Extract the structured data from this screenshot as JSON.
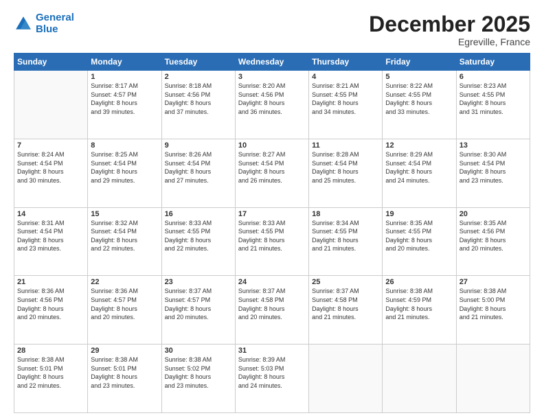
{
  "logo": {
    "line1": "General",
    "line2": "Blue"
  },
  "title": "December 2025",
  "location": "Egreville, France",
  "days_header": [
    "Sunday",
    "Monday",
    "Tuesday",
    "Wednesday",
    "Thursday",
    "Friday",
    "Saturday"
  ],
  "weeks": [
    [
      {
        "day": "",
        "sunrise": "",
        "sunset": "",
        "daylight": ""
      },
      {
        "day": "1",
        "sunrise": "Sunrise: 8:17 AM",
        "sunset": "Sunset: 4:57 PM",
        "daylight": "Daylight: 8 hours",
        "daylight2": "and 39 minutes."
      },
      {
        "day": "2",
        "sunrise": "Sunrise: 8:18 AM",
        "sunset": "Sunset: 4:56 PM",
        "daylight": "Daylight: 8 hours",
        "daylight2": "and 37 minutes."
      },
      {
        "day": "3",
        "sunrise": "Sunrise: 8:20 AM",
        "sunset": "Sunset: 4:56 PM",
        "daylight": "Daylight: 8 hours",
        "daylight2": "and 36 minutes."
      },
      {
        "day": "4",
        "sunrise": "Sunrise: 8:21 AM",
        "sunset": "Sunset: 4:55 PM",
        "daylight": "Daylight: 8 hours",
        "daylight2": "and 34 minutes."
      },
      {
        "day": "5",
        "sunrise": "Sunrise: 8:22 AM",
        "sunset": "Sunset: 4:55 PM",
        "daylight": "Daylight: 8 hours",
        "daylight2": "and 33 minutes."
      },
      {
        "day": "6",
        "sunrise": "Sunrise: 8:23 AM",
        "sunset": "Sunset: 4:55 PM",
        "daylight": "Daylight: 8 hours",
        "daylight2": "and 31 minutes."
      }
    ],
    [
      {
        "day": "7",
        "sunrise": "Sunrise: 8:24 AM",
        "sunset": "Sunset: 4:54 PM",
        "daylight": "Daylight: 8 hours",
        "daylight2": "and 30 minutes."
      },
      {
        "day": "8",
        "sunrise": "Sunrise: 8:25 AM",
        "sunset": "Sunset: 4:54 PM",
        "daylight": "Daylight: 8 hours",
        "daylight2": "and 29 minutes."
      },
      {
        "day": "9",
        "sunrise": "Sunrise: 8:26 AM",
        "sunset": "Sunset: 4:54 PM",
        "daylight": "Daylight: 8 hours",
        "daylight2": "and 27 minutes."
      },
      {
        "day": "10",
        "sunrise": "Sunrise: 8:27 AM",
        "sunset": "Sunset: 4:54 PM",
        "daylight": "Daylight: 8 hours",
        "daylight2": "and 26 minutes."
      },
      {
        "day": "11",
        "sunrise": "Sunrise: 8:28 AM",
        "sunset": "Sunset: 4:54 PM",
        "daylight": "Daylight: 8 hours",
        "daylight2": "and 25 minutes."
      },
      {
        "day": "12",
        "sunrise": "Sunrise: 8:29 AM",
        "sunset": "Sunset: 4:54 PM",
        "daylight": "Daylight: 8 hours",
        "daylight2": "and 24 minutes."
      },
      {
        "day": "13",
        "sunrise": "Sunrise: 8:30 AM",
        "sunset": "Sunset: 4:54 PM",
        "daylight": "Daylight: 8 hours",
        "daylight2": "and 23 minutes."
      }
    ],
    [
      {
        "day": "14",
        "sunrise": "Sunrise: 8:31 AM",
        "sunset": "Sunset: 4:54 PM",
        "daylight": "Daylight: 8 hours",
        "daylight2": "and 23 minutes."
      },
      {
        "day": "15",
        "sunrise": "Sunrise: 8:32 AM",
        "sunset": "Sunset: 4:54 PM",
        "daylight": "Daylight: 8 hours",
        "daylight2": "and 22 minutes."
      },
      {
        "day": "16",
        "sunrise": "Sunrise: 8:33 AM",
        "sunset": "Sunset: 4:55 PM",
        "daylight": "Daylight: 8 hours",
        "daylight2": "and 22 minutes."
      },
      {
        "day": "17",
        "sunrise": "Sunrise: 8:33 AM",
        "sunset": "Sunset: 4:55 PM",
        "daylight": "Daylight: 8 hours",
        "daylight2": "and 21 minutes."
      },
      {
        "day": "18",
        "sunrise": "Sunrise: 8:34 AM",
        "sunset": "Sunset: 4:55 PM",
        "daylight": "Daylight: 8 hours",
        "daylight2": "and 21 minutes."
      },
      {
        "day": "19",
        "sunrise": "Sunrise: 8:35 AM",
        "sunset": "Sunset: 4:55 PM",
        "daylight": "Daylight: 8 hours",
        "daylight2": "and 20 minutes."
      },
      {
        "day": "20",
        "sunrise": "Sunrise: 8:35 AM",
        "sunset": "Sunset: 4:56 PM",
        "daylight": "Daylight: 8 hours",
        "daylight2": "and 20 minutes."
      }
    ],
    [
      {
        "day": "21",
        "sunrise": "Sunrise: 8:36 AM",
        "sunset": "Sunset: 4:56 PM",
        "daylight": "Daylight: 8 hours",
        "daylight2": "and 20 minutes."
      },
      {
        "day": "22",
        "sunrise": "Sunrise: 8:36 AM",
        "sunset": "Sunset: 4:57 PM",
        "daylight": "Daylight: 8 hours",
        "daylight2": "and 20 minutes."
      },
      {
        "day": "23",
        "sunrise": "Sunrise: 8:37 AM",
        "sunset": "Sunset: 4:57 PM",
        "daylight": "Daylight: 8 hours",
        "daylight2": "and 20 minutes."
      },
      {
        "day": "24",
        "sunrise": "Sunrise: 8:37 AM",
        "sunset": "Sunset: 4:58 PM",
        "daylight": "Daylight: 8 hours",
        "daylight2": "and 20 minutes."
      },
      {
        "day": "25",
        "sunrise": "Sunrise: 8:37 AM",
        "sunset": "Sunset: 4:58 PM",
        "daylight": "Daylight: 8 hours",
        "daylight2": "and 21 minutes."
      },
      {
        "day": "26",
        "sunrise": "Sunrise: 8:38 AM",
        "sunset": "Sunset: 4:59 PM",
        "daylight": "Daylight: 8 hours",
        "daylight2": "and 21 minutes."
      },
      {
        "day": "27",
        "sunrise": "Sunrise: 8:38 AM",
        "sunset": "Sunset: 5:00 PM",
        "daylight": "Daylight: 8 hours",
        "daylight2": "and 21 minutes."
      }
    ],
    [
      {
        "day": "28",
        "sunrise": "Sunrise: 8:38 AM",
        "sunset": "Sunset: 5:01 PM",
        "daylight": "Daylight: 8 hours",
        "daylight2": "and 22 minutes."
      },
      {
        "day": "29",
        "sunrise": "Sunrise: 8:38 AM",
        "sunset": "Sunset: 5:01 PM",
        "daylight": "Daylight: 8 hours",
        "daylight2": "and 23 minutes."
      },
      {
        "day": "30",
        "sunrise": "Sunrise: 8:38 AM",
        "sunset": "Sunset: 5:02 PM",
        "daylight": "Daylight: 8 hours",
        "daylight2": "and 23 minutes."
      },
      {
        "day": "31",
        "sunrise": "Sunrise: 8:39 AM",
        "sunset": "Sunset: 5:03 PM",
        "daylight": "Daylight: 8 hours",
        "daylight2": "and 24 minutes."
      },
      {
        "day": "",
        "sunrise": "",
        "sunset": "",
        "daylight": "",
        "daylight2": ""
      },
      {
        "day": "",
        "sunrise": "",
        "sunset": "",
        "daylight": "",
        "daylight2": ""
      },
      {
        "day": "",
        "sunrise": "",
        "sunset": "",
        "daylight": "",
        "daylight2": ""
      }
    ]
  ]
}
